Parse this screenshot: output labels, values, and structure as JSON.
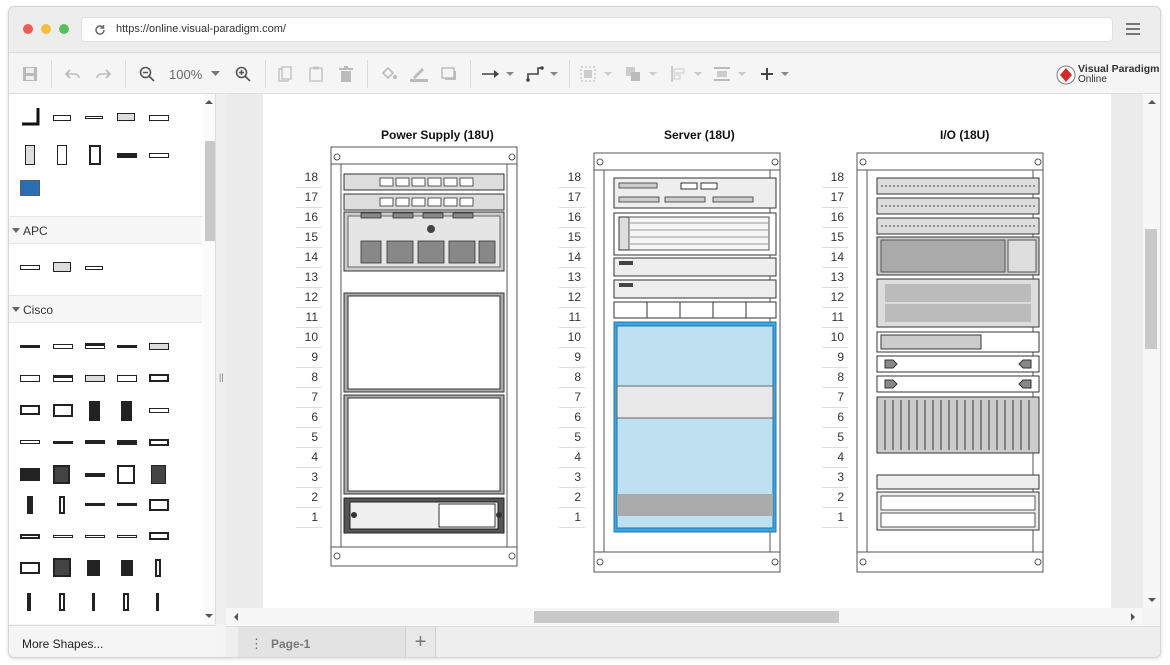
{
  "browser": {
    "url": "https://online.visual-paradigm.com/",
    "dot_colors": [
      "#ec5b56",
      "#f4bd40",
      "#56c15c"
    ]
  },
  "toolbar": {
    "zoom": "100%",
    "icons": [
      "save-icon",
      "undo-icon",
      "redo-icon",
      "zoom-out-icon",
      "zoom-dropdown-icon",
      "zoom-in-icon",
      "copy-icon",
      "paste-icon",
      "delete-icon",
      "fill-color-icon",
      "line-color-icon",
      "shadow-icon",
      "connector-style-icon",
      "connector-route-icon",
      "group-icon",
      "arrange-icon",
      "align-icon",
      "distribute-icon",
      "add-icon"
    ]
  },
  "logo": {
    "line1": "Visual Paradigm",
    "line2": "Online"
  },
  "sidebar": {
    "sections": [
      {
        "name": "APC"
      },
      {
        "name": "Cisco"
      }
    ],
    "more_shapes": "More Shapes..."
  },
  "page_tab": {
    "label": "Page-1",
    "add_label": "+",
    "menu_label": "⋮"
  },
  "racks": [
    {
      "title": "Power Supply (18U)"
    },
    {
      "title": "Server (18U)"
    },
    {
      "title": "I/O (18U)"
    }
  ],
  "rack_units": [
    "18",
    "17",
    "16",
    "15",
    "14",
    "13",
    "12",
    "11",
    "10",
    "9",
    "8",
    "7",
    "6",
    "5",
    "4",
    "3",
    "2",
    "1"
  ],
  "colors": {
    "accent_blue": "#3aa6e6",
    "server_light_blue": "#bfe0f1",
    "brand_red": "#d12c2c"
  }
}
